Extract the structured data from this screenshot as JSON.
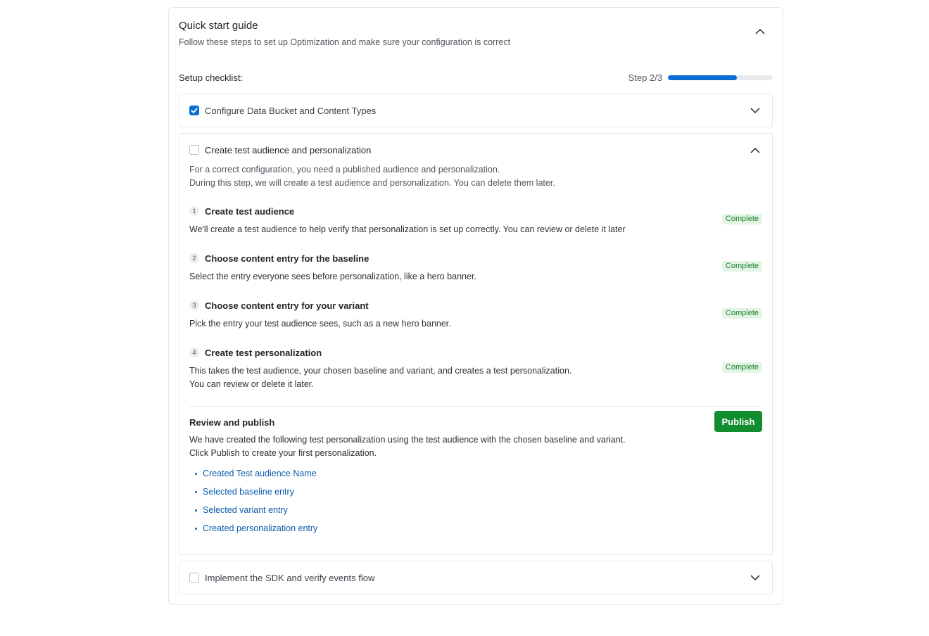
{
  "guide": {
    "title": "Quick start guide",
    "subtitle": "Follow these steps to set up Optimization and make sure your configuration is correct",
    "collapse_icon": "chevron-up-icon"
  },
  "checklist": {
    "label": "Setup checklist:",
    "step_text": "Step 2/3",
    "progress_fraction": 0.66,
    "accent_color": "#0b6cd4"
  },
  "sections": [
    {
      "title": "Configure Data Bucket and Content Types",
      "checked": true,
      "expanded": false
    },
    {
      "title": "Create test audience and personalization",
      "checked": false,
      "expanded": true,
      "intro_line1": "For a correct configuration, you need a published audience and personalization.",
      "intro_line2": "During this step, we will create a test audience and personalization. You can delete them later.",
      "steps": [
        {
          "num": "1",
          "title": "Create test audience",
          "desc": "We'll create a test audience to help verify that personalization is set up correctly. You can review or delete it later",
          "desc2": "",
          "status": "Complete"
        },
        {
          "num": "2",
          "title": "Choose content entry for the baseline",
          "desc": "Select the entry everyone sees before personalization, like a hero banner.",
          "desc2": "",
          "status": "Complete"
        },
        {
          "num": "3",
          "title": "Choose content entry for your variant",
          "desc": "Pick the entry your test audience sees, such as a new hero banner.",
          "desc2": "",
          "status": "Complete"
        },
        {
          "num": "4",
          "title": "Create test personalization",
          "desc": "This takes the test audience, your chosen baseline and variant, and creates a test personalization.",
          "desc2": "You can review or delete it later.",
          "status": "Complete"
        }
      ],
      "review": {
        "title": "Review and publish",
        "desc1": "We have created the following test personalization using the test audience with the chosen baseline and variant.",
        "desc2": "Click Publish to create your first personalization.",
        "publish_label": "Publish",
        "publish_color": "#118c2e",
        "links": [
          "Created Test audience Name",
          "Selected baseline entry",
          "Selected variant entry",
          "Created personalization entry"
        ]
      }
    },
    {
      "title": "Implement the SDK and verify events flow",
      "checked": false,
      "expanded": false
    }
  ],
  "status_color": "#1b7d2e",
  "link_color": "#0b5cad"
}
